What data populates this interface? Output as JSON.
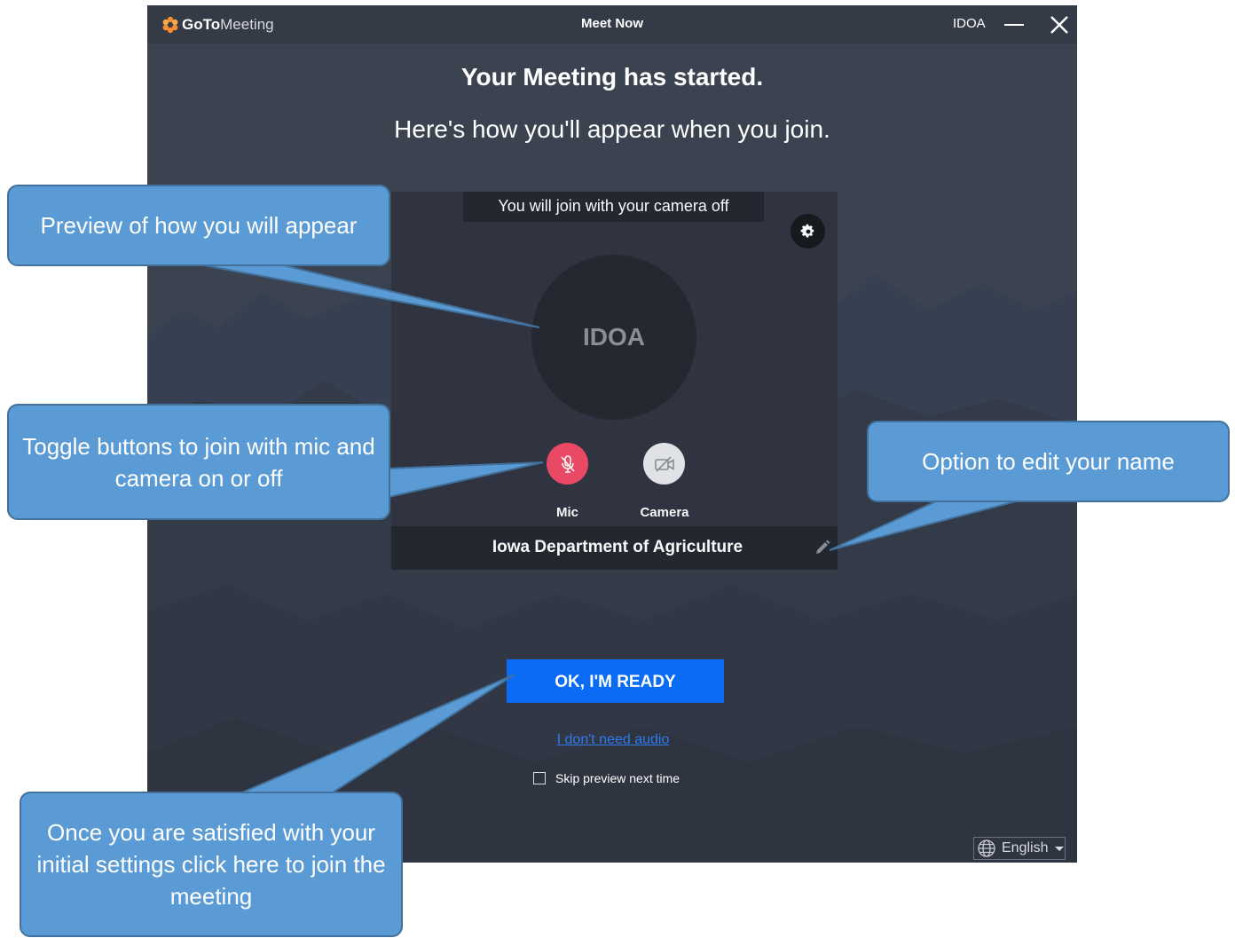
{
  "window": {
    "logo_goto": "GoTo",
    "logo_meeting": "Meeting",
    "title": "Meet Now",
    "user": "IDOA"
  },
  "main": {
    "heading": "Your Meeting has started.",
    "subheading": "Here's how you'll appear when you join.",
    "camera_note": "You will join with your camera off",
    "avatar_initials": "IDOA",
    "mic_label": "Mic",
    "camera_label": "Camera",
    "mic_state": "off",
    "camera_state": "off",
    "display_name": "Iowa Department of Agriculture",
    "ready_button": "OK, I'M READY",
    "no_audio_link": "I don't need audio",
    "skip_preview_label": "Skip preview next time",
    "skip_preview_checked": false,
    "language": "English"
  },
  "callouts": [
    {
      "text": "Preview of how you will appear"
    },
    {
      "text": "Toggle buttons to join with mic and camera on or off"
    },
    {
      "text": "Option to edit your name"
    },
    {
      "text": "Once you are satisfied with your initial settings click here to join the meeting"
    }
  ],
  "colors": {
    "background": "#3b4250",
    "titlebar": "#343a46",
    "accent_blue": "#0a6cf5",
    "mic_off": "#f04a67",
    "brand_orange": "#f68d2e",
    "callout_fill": "#5b9bd5",
    "callout_border": "#41719c"
  },
  "icons": {
    "logo": "goto-flower-icon",
    "minimize": "minimize-icon",
    "close": "close-icon",
    "settings": "gear-icon",
    "mic": "mic-off-icon",
    "camera": "camera-off-icon",
    "edit": "pencil-icon",
    "language": "globe-icon"
  }
}
